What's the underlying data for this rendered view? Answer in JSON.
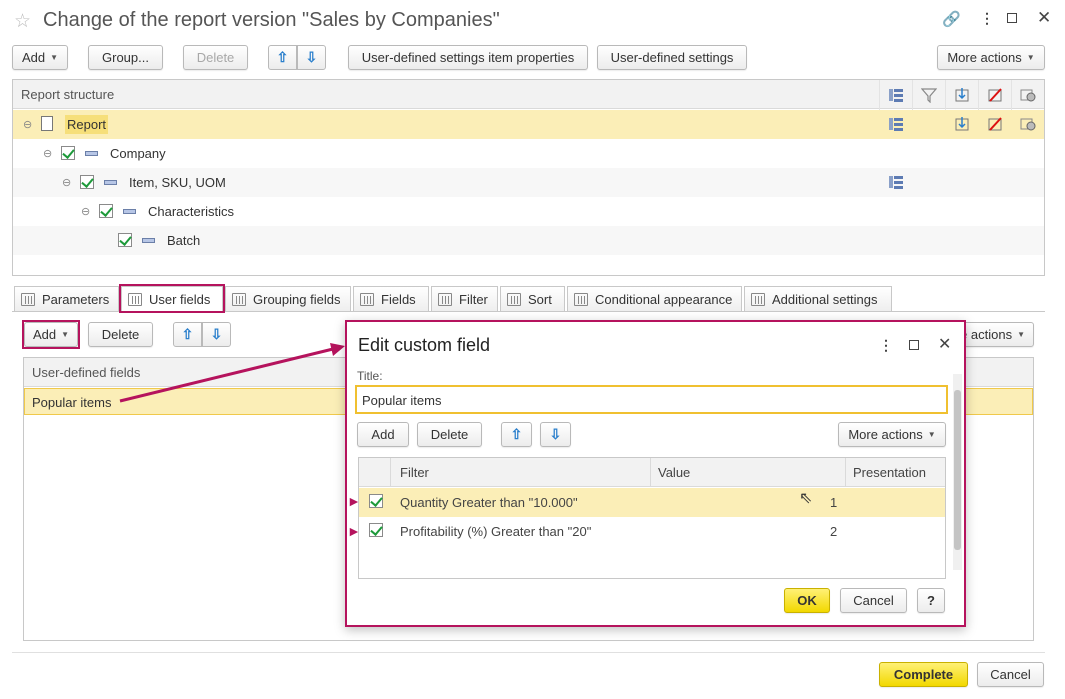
{
  "window": {
    "title": "Change of the report version \"Sales by Companies\"",
    "link_icon": "link-icon",
    "menu_icon": "more-icon",
    "maximize_icon": "maximize-icon",
    "close_icon": "close-icon"
  },
  "toolbar": {
    "add_label": "Add",
    "group_label": "Group...",
    "delete_label": "Delete",
    "item_properties_label": "User-defined settings item properties",
    "user_settings_label": "User-defined settings",
    "more_actions_label": "More actions"
  },
  "structure": {
    "header": "Report structure",
    "rows": [
      {
        "label": "Report"
      },
      {
        "label": "Company"
      },
      {
        "label": "Item, SKU, UOM"
      },
      {
        "label": "Characteristics"
      },
      {
        "label": "Batch"
      }
    ]
  },
  "tabs": [
    {
      "label": "Parameters"
    },
    {
      "label": "User fields"
    },
    {
      "label": "Grouping fields"
    },
    {
      "label": "Fields"
    },
    {
      "label": "Filter"
    },
    {
      "label": "Sort"
    },
    {
      "label": "Conditional appearance"
    },
    {
      "label": "Additional settings"
    }
  ],
  "user_fields": {
    "add_label": "Add",
    "delete_label": "Delete",
    "more_actions_label": "e actions",
    "header": "User-defined fields",
    "rows": [
      {
        "label": "Popular items"
      }
    ]
  },
  "dialog": {
    "title": "Edit custom field",
    "title_label": "Title:",
    "title_value": "Popular items",
    "add_label": "Add",
    "delete_label": "Delete",
    "more_actions_label": "More actions",
    "columns": {
      "filter": "Filter",
      "value": "Value",
      "presentation": "Presentation"
    },
    "rows": [
      {
        "filter": "Quantity Greater than \"10.000\"",
        "value": "1",
        "presentation": ""
      },
      {
        "filter": "Profitability (%) Greater than \"20\"",
        "value": "2",
        "presentation": ""
      }
    ],
    "ok_label": "OK",
    "cancel_label": "Cancel",
    "help_label": "?"
  },
  "footer": {
    "complete_label": "Complete",
    "cancel_label": "Cancel"
  },
  "colors": {
    "accent_highlight": "#b5135d",
    "selected_row": "#fbeeb7",
    "primary_button": "#f2d800",
    "check": "#1d9a3a"
  }
}
